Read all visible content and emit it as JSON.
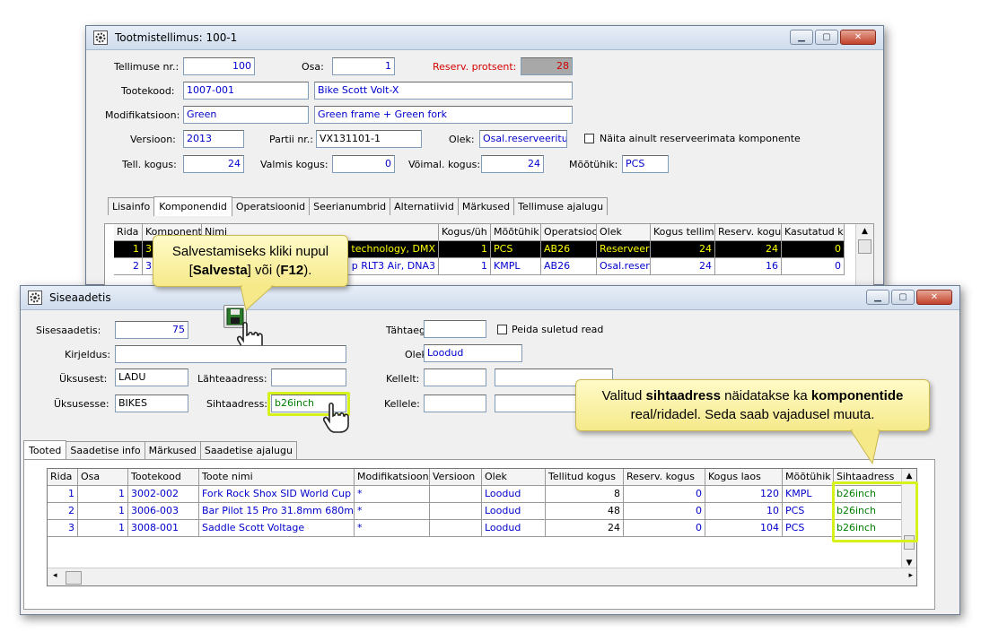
{
  "back_window": {
    "title": "Tootmistellimus: 100-1",
    "fields": {
      "tellimuse_nr_label": "Tellimuse nr.:",
      "tellimuse_nr": "100",
      "osa_label": "Osa:",
      "osa": "1",
      "reserv_label": "Reserv. protsent:",
      "reserv": "28",
      "tootekood_label": "Tootekood:",
      "tootekood": "1007-001",
      "tootekood_name": "Bike Scott Volt-X",
      "modifikatsioon_label": "Modifikatsioon:",
      "modifikatsioon": "Green",
      "modifikatsioon_desc": "Green frame + Green fork",
      "versioon_label": "Versioon:",
      "versioon": "2013",
      "partii_label": "Partii nr.:",
      "partii": "VX131101-1",
      "olek_label": "Olek:",
      "olek": "Osal.reserveeritud",
      "naita_label": "Näita ainult reserveerimata komponente",
      "tell_kogus_label": "Tell. kogus:",
      "tell_kogus": "24",
      "valmis_kogus_label": "Valmis kogus:",
      "valmis_kogus": "0",
      "voimal_kogus_label": "Võimal. kogus:",
      "voimal_kogus": "24",
      "mootuhik_label": "Mõõtühik:",
      "mootuhik": "PCS"
    },
    "tabs": [
      "Lisainfo",
      "Komponendid",
      "Operatsioonid",
      "Seerianumbrid",
      "Alternatiivid",
      "Märkused",
      "Tellimuse ajalugu"
    ],
    "grid": {
      "headers": [
        "Rida",
        "Komponent",
        "Nimi",
        "Kogus/üh",
        "Mõõtühik",
        "Operatsioo",
        "Olek",
        "Kogus tellim.",
        "Reserv. kogu",
        "Kasutatud k"
      ],
      "rows": [
        [
          "1",
          "3",
          "technology, DMX",
          "1",
          "PCS",
          "AB26",
          "Reserveeri",
          "24",
          "24",
          "0"
        ],
        [
          "2",
          "3",
          "p RLT3 Air, DNA3",
          "1",
          "KMPL",
          "AB26",
          "Osal.reserv",
          "24",
          "16",
          "0"
        ]
      ]
    }
  },
  "front_window": {
    "title": "Siseaadetis",
    "fields": {
      "siseaadetis_label": "Sisesaadetis:",
      "siseaadetis": "75",
      "tahtaeg_label": "Tähtaeg:",
      "peida_label": "Peida suletud read",
      "kirjeldus_label": "Kirjeldus:",
      "olek_label": "Olek:",
      "olek": "Loodud",
      "uksusest_label": "Üksusest:",
      "uksusest": "LADU",
      "lahteaadress_label": "Lähteaadress:",
      "kellelt_label": "Kellelt:",
      "uksusesse_label": "Üksusesse:",
      "uksusesse": "BIKES",
      "sihtaadress_label": "Sihtaadress:",
      "sihtaadress": "b26inch",
      "kellele_label": "Kellele:"
    },
    "tabs": [
      "Tooted",
      "Saadetise info",
      "Märkused",
      "Saadetise ajalugu"
    ],
    "grid": {
      "headers": [
        "Rida",
        "Osa",
        "Tootekood",
        "Toote nimi",
        "Modifikatsioon",
        "Versioon",
        "Olek",
        "Tellitud kogus",
        "Reserv. kogus",
        "Kogus laos",
        "Mõõtühik",
        "Sihtaadress"
      ],
      "rows": [
        [
          "1",
          "1",
          "3002-002",
          "Fork Rock Shox SID World Cup",
          "*",
          "",
          "Loodud",
          "8",
          "0",
          "120",
          "KMPL",
          "b26inch"
        ],
        [
          "2",
          "1",
          "3006-003",
          "Bar Pilot 15 Pro 31.8mm 680mm",
          "*",
          "",
          "Loodud",
          "48",
          "0",
          "10",
          "PCS",
          "b26inch"
        ],
        [
          "3",
          "1",
          "3008-001",
          "Saddle Scott Voltage",
          "*",
          "",
          "Loodud",
          "24",
          "0",
          "104",
          "PCS",
          "b26inch"
        ]
      ]
    }
  },
  "callouts": {
    "save_pre": "Salvestamiseks kliki nupul",
    "save_btn": "Salvesta",
    "save_mid": " või (",
    "save_key": "F12",
    "save_post": ").",
    "addr_pre": "Valitud ",
    "addr_b1": "sihtaadress",
    "addr_mid": " näidatakse ka ",
    "addr_b2": "komponentide",
    "addr_line2": "real/ridadel. Seda saab vajadusel muuta."
  },
  "icons": [
    "gear-app-icon",
    "save-floppy-icon",
    "hand-cursor-icon"
  ]
}
